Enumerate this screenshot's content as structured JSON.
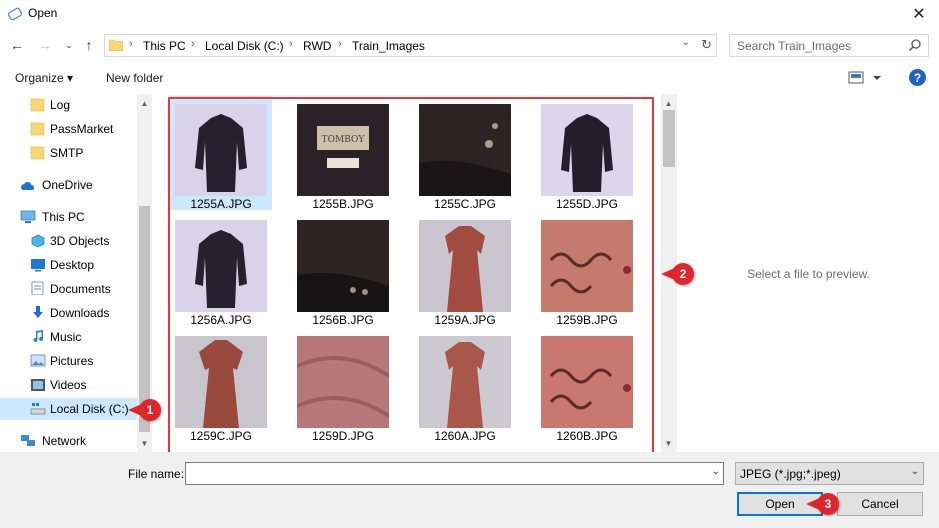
{
  "window": {
    "title": "Open",
    "close_icon": "close-icon"
  },
  "nav": {
    "back_icon": "arrow-left-icon",
    "forward_icon": "arrow-right-icon",
    "recent_icon": "chevron-down-icon",
    "up_icon": "arrow-up-icon",
    "breadcrumbs": [
      "This PC",
      "Local Disk (C:)",
      "RWD",
      "Train_Images"
    ],
    "search_placeholder": "Search Train_Images"
  },
  "toolbar": {
    "organize_label": "Organize ▾",
    "new_folder_label": "New folder",
    "help_label": "?"
  },
  "sidebar": {
    "items": [
      {
        "label": "Log",
        "icon": "folder-icon"
      },
      {
        "label": "PassMarket",
        "icon": "folder-icon"
      },
      {
        "label": "SMTP",
        "icon": "folder-icon"
      },
      {
        "label": "OneDrive",
        "icon": "cloud-icon"
      },
      {
        "label": "This PC",
        "icon": "computer-icon"
      },
      {
        "label": "3D Objects",
        "icon": "cube-icon"
      },
      {
        "label": "Desktop",
        "icon": "desktop-icon"
      },
      {
        "label": "Documents",
        "icon": "documents-icon"
      },
      {
        "label": "Downloads",
        "icon": "download-icon"
      },
      {
        "label": "Music",
        "icon": "music-icon"
      },
      {
        "label": "Pictures",
        "icon": "pictures-icon"
      },
      {
        "label": "Videos",
        "icon": "videos-icon"
      },
      {
        "label": "Local Disk (C:)",
        "icon": "drive-icon",
        "selected": true
      },
      {
        "label": "Network",
        "icon": "network-icon"
      }
    ]
  },
  "files": [
    {
      "name": "1255A.JPG",
      "selected": true
    },
    {
      "name": "1255B.JPG"
    },
    {
      "name": "1255C.JPG"
    },
    {
      "name": "1255D.JPG"
    },
    {
      "name": "1256A.JPG"
    },
    {
      "name": "1256B.JPG"
    },
    {
      "name": "1259A.JPG"
    },
    {
      "name": "1259B.JPG"
    },
    {
      "name": "1259C.JPG"
    },
    {
      "name": "1259D.JPG"
    },
    {
      "name": "1260A.JPG"
    },
    {
      "name": "1260B.JPG"
    }
  ],
  "preview": {
    "message": "Select a file to preview."
  },
  "footer": {
    "file_name_label": "File name:",
    "file_name_value": "",
    "file_type": "JPEG (*.jpg;*.jpeg)",
    "open_label": "Open",
    "cancel_label": "Cancel"
  },
  "callouts": [
    "1",
    "2",
    "3"
  ],
  "colors": {
    "accent": "#0078d7",
    "selection": "#cce8ff",
    "callout": "#e0262b",
    "highlight_border": "#e4363c"
  }
}
